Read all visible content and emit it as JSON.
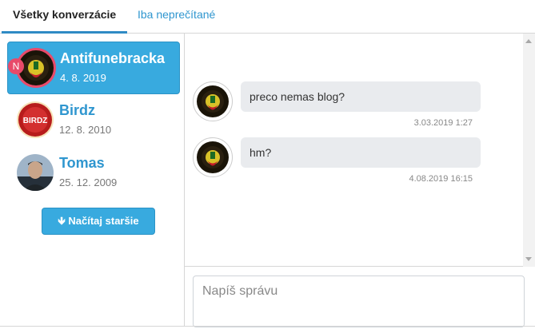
{
  "tabs": {
    "all": "Všetky konverzácie",
    "unread": "Iba neprečítané"
  },
  "conversations": [
    {
      "name": "Antifunebracka",
      "date": "4. 8. 2019",
      "badge": "N",
      "active": true
    },
    {
      "name": "Birdz",
      "date": "12. 8. 2010",
      "avatar_text": "BIRDZ"
    },
    {
      "name": "Tomas",
      "date": "25. 12. 2009"
    }
  ],
  "load_older": "Načítaj staršie",
  "messages": [
    {
      "text": "preco nemas blog?",
      "time": "3.03.2019 1:27"
    },
    {
      "text": "hm?",
      "time": "4.08.2019 16:15"
    }
  ],
  "composer": {
    "placeholder": "Napíš správu"
  },
  "colors": {
    "accent": "#38aadf",
    "badge": "#e84a6a",
    "link": "#2f96cf"
  },
  "icons": {
    "load_older": "arrow-down-icon"
  }
}
